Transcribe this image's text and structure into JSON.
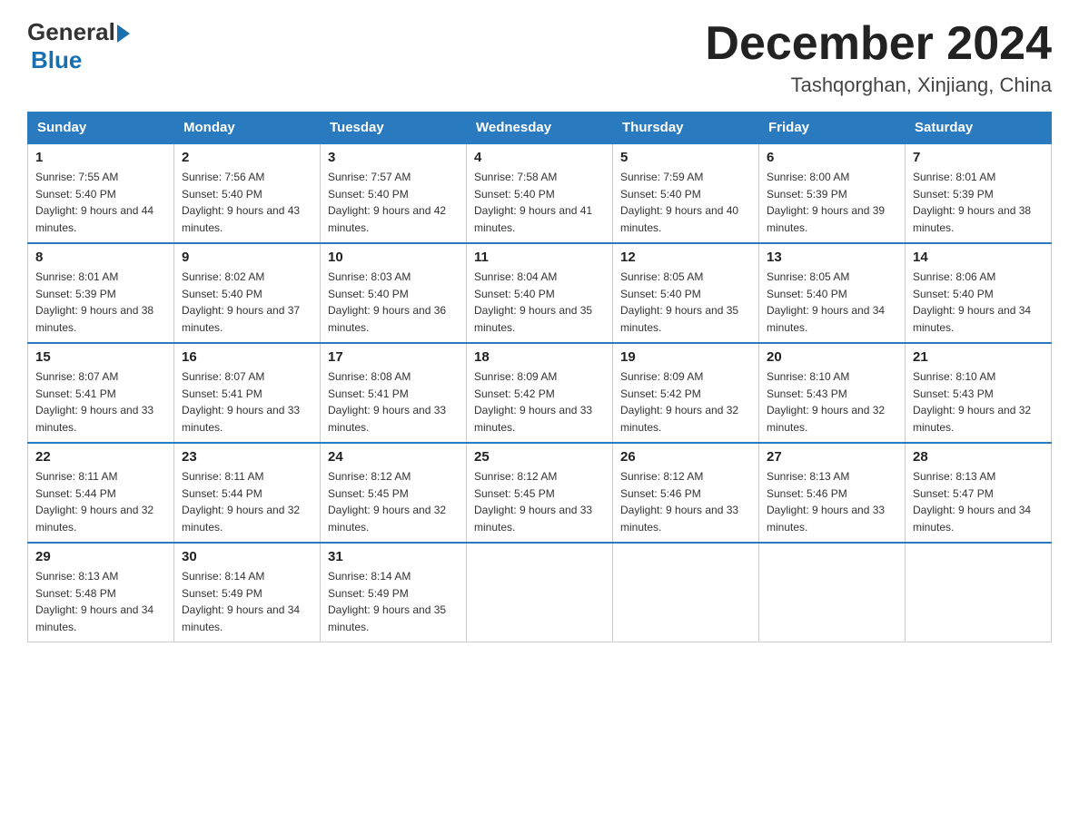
{
  "logo": {
    "general": "General",
    "blue": "Blue"
  },
  "header": {
    "month_year": "December 2024",
    "location": "Tashqorghan, Xinjiang, China"
  },
  "days_of_week": [
    "Sunday",
    "Monday",
    "Tuesday",
    "Wednesday",
    "Thursday",
    "Friday",
    "Saturday"
  ],
  "weeks": [
    [
      {
        "day": "1",
        "sunrise": "7:55 AM",
        "sunset": "5:40 PM",
        "daylight": "9 hours and 44 minutes."
      },
      {
        "day": "2",
        "sunrise": "7:56 AM",
        "sunset": "5:40 PM",
        "daylight": "9 hours and 43 minutes."
      },
      {
        "day": "3",
        "sunrise": "7:57 AM",
        "sunset": "5:40 PM",
        "daylight": "9 hours and 42 minutes."
      },
      {
        "day": "4",
        "sunrise": "7:58 AM",
        "sunset": "5:40 PM",
        "daylight": "9 hours and 41 minutes."
      },
      {
        "day": "5",
        "sunrise": "7:59 AM",
        "sunset": "5:40 PM",
        "daylight": "9 hours and 40 minutes."
      },
      {
        "day": "6",
        "sunrise": "8:00 AM",
        "sunset": "5:39 PM",
        "daylight": "9 hours and 39 minutes."
      },
      {
        "day": "7",
        "sunrise": "8:01 AM",
        "sunset": "5:39 PM",
        "daylight": "9 hours and 38 minutes."
      }
    ],
    [
      {
        "day": "8",
        "sunrise": "8:01 AM",
        "sunset": "5:39 PM",
        "daylight": "9 hours and 38 minutes."
      },
      {
        "day": "9",
        "sunrise": "8:02 AM",
        "sunset": "5:40 PM",
        "daylight": "9 hours and 37 minutes."
      },
      {
        "day": "10",
        "sunrise": "8:03 AM",
        "sunset": "5:40 PM",
        "daylight": "9 hours and 36 minutes."
      },
      {
        "day": "11",
        "sunrise": "8:04 AM",
        "sunset": "5:40 PM",
        "daylight": "9 hours and 35 minutes."
      },
      {
        "day": "12",
        "sunrise": "8:05 AM",
        "sunset": "5:40 PM",
        "daylight": "9 hours and 35 minutes."
      },
      {
        "day": "13",
        "sunrise": "8:05 AM",
        "sunset": "5:40 PM",
        "daylight": "9 hours and 34 minutes."
      },
      {
        "day": "14",
        "sunrise": "8:06 AM",
        "sunset": "5:40 PM",
        "daylight": "9 hours and 34 minutes."
      }
    ],
    [
      {
        "day": "15",
        "sunrise": "8:07 AM",
        "sunset": "5:41 PM",
        "daylight": "9 hours and 33 minutes."
      },
      {
        "day": "16",
        "sunrise": "8:07 AM",
        "sunset": "5:41 PM",
        "daylight": "9 hours and 33 minutes."
      },
      {
        "day": "17",
        "sunrise": "8:08 AM",
        "sunset": "5:41 PM",
        "daylight": "9 hours and 33 minutes."
      },
      {
        "day": "18",
        "sunrise": "8:09 AM",
        "sunset": "5:42 PM",
        "daylight": "9 hours and 33 minutes."
      },
      {
        "day": "19",
        "sunrise": "8:09 AM",
        "sunset": "5:42 PM",
        "daylight": "9 hours and 32 minutes."
      },
      {
        "day": "20",
        "sunrise": "8:10 AM",
        "sunset": "5:43 PM",
        "daylight": "9 hours and 32 minutes."
      },
      {
        "day": "21",
        "sunrise": "8:10 AM",
        "sunset": "5:43 PM",
        "daylight": "9 hours and 32 minutes."
      }
    ],
    [
      {
        "day": "22",
        "sunrise": "8:11 AM",
        "sunset": "5:44 PM",
        "daylight": "9 hours and 32 minutes."
      },
      {
        "day": "23",
        "sunrise": "8:11 AM",
        "sunset": "5:44 PM",
        "daylight": "9 hours and 32 minutes."
      },
      {
        "day": "24",
        "sunrise": "8:12 AM",
        "sunset": "5:45 PM",
        "daylight": "9 hours and 32 minutes."
      },
      {
        "day": "25",
        "sunrise": "8:12 AM",
        "sunset": "5:45 PM",
        "daylight": "9 hours and 33 minutes."
      },
      {
        "day": "26",
        "sunrise": "8:12 AM",
        "sunset": "5:46 PM",
        "daylight": "9 hours and 33 minutes."
      },
      {
        "day": "27",
        "sunrise": "8:13 AM",
        "sunset": "5:46 PM",
        "daylight": "9 hours and 33 minutes."
      },
      {
        "day": "28",
        "sunrise": "8:13 AM",
        "sunset": "5:47 PM",
        "daylight": "9 hours and 34 minutes."
      }
    ],
    [
      {
        "day": "29",
        "sunrise": "8:13 AM",
        "sunset": "5:48 PM",
        "daylight": "9 hours and 34 minutes."
      },
      {
        "day": "30",
        "sunrise": "8:14 AM",
        "sunset": "5:49 PM",
        "daylight": "9 hours and 34 minutes."
      },
      {
        "day": "31",
        "sunrise": "8:14 AM",
        "sunset": "5:49 PM",
        "daylight": "9 hours and 35 minutes."
      },
      null,
      null,
      null,
      null
    ]
  ],
  "labels": {
    "sunrise": "Sunrise: ",
    "sunset": "Sunset: ",
    "daylight": "Daylight: "
  }
}
